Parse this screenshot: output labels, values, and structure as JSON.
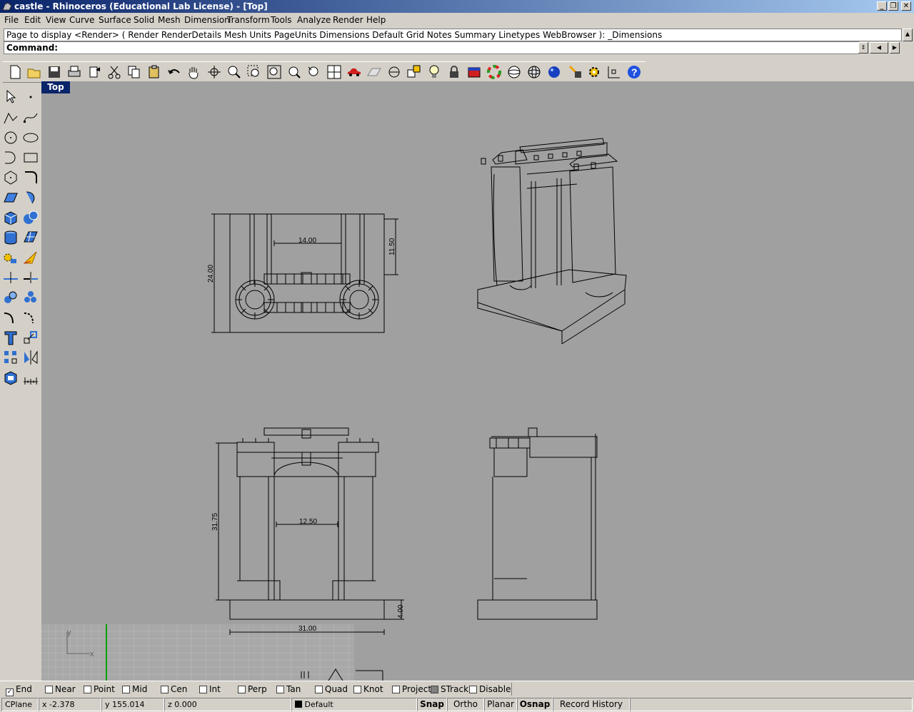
{
  "window": {
    "title": "castle - Rhinoceros (Educational Lab License) - [Top]",
    "minimize": "_",
    "restore": "❐",
    "close": "✕"
  },
  "menu": [
    "File",
    "Edit",
    "View",
    "Curve",
    "Surface",
    "Solid",
    "Mesh",
    "Dimension",
    "Transform",
    "Tools",
    "Analyze",
    "Render",
    "Help"
  ],
  "command": {
    "history": "Page to display <Render> ( Render  RenderDetails  Mesh  Units  PageUnits  Dimensions  Default  Grid  Notes  Summary  Linetypes  WebBrowser ): _Dimensions",
    "prompt": "Command:",
    "value": ""
  },
  "toolbar_icons": [
    "new-icon",
    "open-icon",
    "save-icon",
    "print-icon",
    "export-icon",
    "cut-icon",
    "copy-icon",
    "paste-icon",
    "undo-icon",
    "pan-icon",
    "rotate-view-icon",
    "zoom-icon",
    "zoom-window-icon",
    "zoom-extents-icon",
    "zoom-selected-icon",
    "undo-view-icon",
    "four-viewports-icon",
    "car-icon",
    "grid-icon",
    "cplane-icon",
    "layer-icon",
    "light-icon",
    "lock-icon",
    "properties-icon",
    "color-wheel-icon",
    "wireframe-sphere-icon",
    "mesh-sphere-icon",
    "render-sphere-icon",
    "render-icon",
    "options-icon",
    "osnap-icon",
    "help-icon"
  ],
  "left_tools": [
    "select-arrow-icon",
    "point-icon",
    "polyline-icon",
    "curve-icon",
    "circle-icon",
    "ellipse-icon",
    "arc-icon",
    "rectangle-icon",
    "polygon-icon",
    "fillet-curve-icon",
    "surface-icon",
    "revolve-icon",
    "box-icon",
    "sphere-icon",
    "cylinder-icon",
    "plane-icon",
    "explode-icon",
    "boolean-icon",
    "trim-icon",
    "split-icon",
    "group-icon",
    "join-icon",
    "offset-icon",
    "blend-icon",
    "text-icon",
    "scale-icon",
    "array-icon",
    "mirror-icon",
    "block-icon",
    "dimension-icon"
  ],
  "viewport": {
    "label": "Top",
    "axis_x": "x",
    "axis_y": "y",
    "dimensions": {
      "top_width": "14.00",
      "top_depth": "11.50",
      "top_height": "24.00",
      "front_height": "31.75",
      "front_gate": "12.50",
      "front_base": "4.00",
      "front_width": "31.00"
    }
  },
  "osnaps": [
    {
      "label": "End",
      "checked": true
    },
    {
      "label": "Near",
      "checked": false
    },
    {
      "label": "Point",
      "checked": false
    },
    {
      "label": "Mid",
      "checked": false
    },
    {
      "label": "Cen",
      "checked": false
    },
    {
      "label": "Int",
      "checked": false
    },
    {
      "label": "Perp",
      "checked": false
    },
    {
      "label": "Tan",
      "checked": false
    },
    {
      "label": "Quad",
      "checked": false
    },
    {
      "label": "Knot",
      "checked": false
    },
    {
      "label": "Project",
      "checked": false
    },
    {
      "label": "STrack",
      "checked": false,
      "disabled": true
    },
    {
      "label": "Disable",
      "checked": false
    }
  ],
  "status": {
    "cplane": "CPlane",
    "x": "x -2.378",
    "y": "y 155.014",
    "z": "z 0.000",
    "layer": "Default",
    "snap": "Snap",
    "ortho": "Ortho",
    "planar": "Planar",
    "osnap": "Osnap",
    "record": "Record History"
  },
  "colors": {
    "title_start": "#0a246a",
    "title_end": "#a6caf0",
    "viewport_bg": "#a0a0a0",
    "chrome": "#d4d0c8"
  }
}
